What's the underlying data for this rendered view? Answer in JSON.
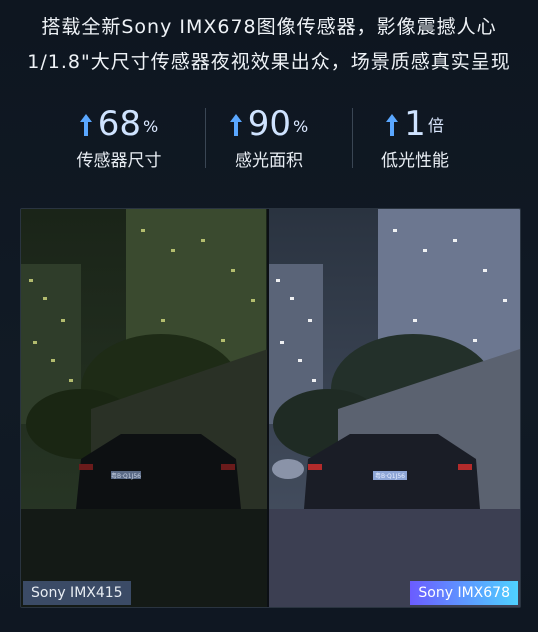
{
  "headline": {
    "line1": "搭载全新Sony IMX678图像传感器，影像震撼人心",
    "line2": "1/1.8\"大尺寸传感器夜视效果出众，场景质感真实呈现"
  },
  "stats": [
    {
      "value": "68",
      "unit": "%",
      "label": "传感器尺寸"
    },
    {
      "value": "90",
      "unit": "%",
      "label": "感光面积"
    },
    {
      "value": "1",
      "unit": "倍",
      "label": "低光性能"
    }
  ],
  "comparison": {
    "left_label": "Sony IMX415",
    "right_label": "Sony IMX678",
    "left_plate": "粤B·Q1J56",
    "right_plate": "粤B·Q1J56"
  },
  "colors": {
    "accent": "#5aa7ff",
    "badge_gradient_start": "#6b5cff",
    "badge_gradient_end": "#4fd1ff"
  },
  "icons": [
    "up-arrow-icon"
  ]
}
